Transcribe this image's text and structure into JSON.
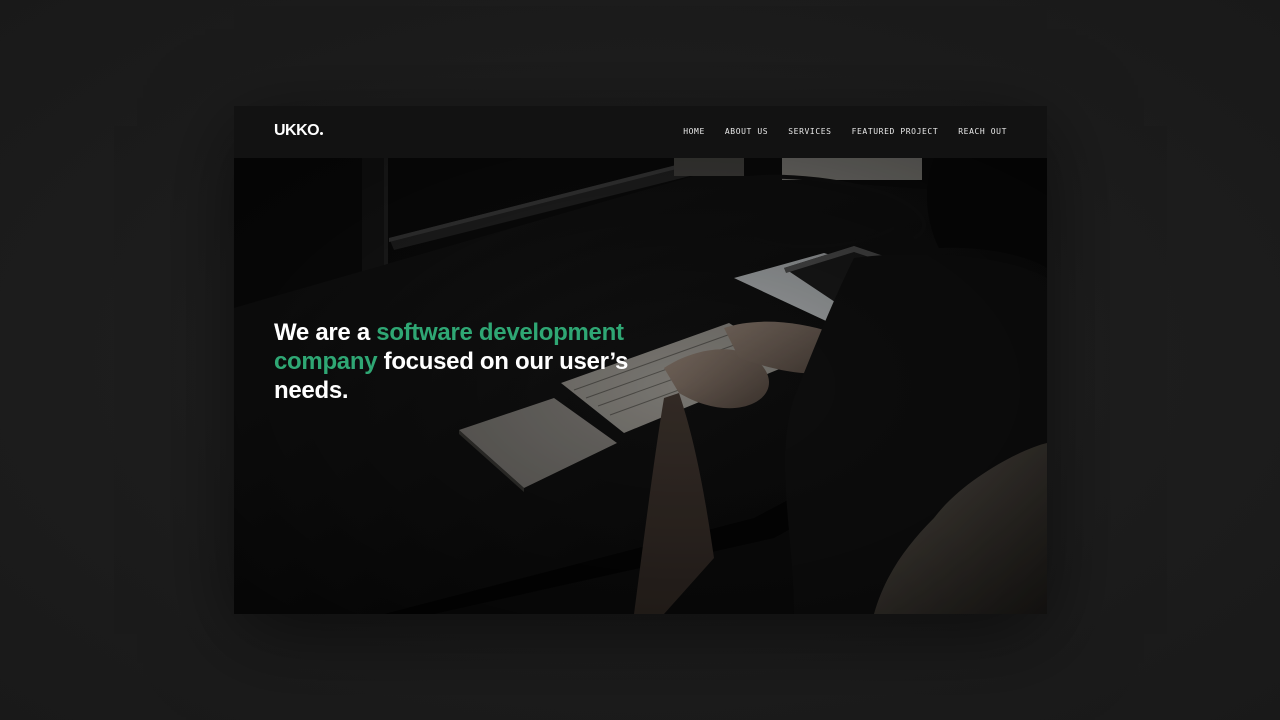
{
  "brand": {
    "logo_text": "UKKO",
    "accent_color": "#2fa774"
  },
  "nav": {
    "items": [
      {
        "label": "HOME"
      },
      {
        "label": "ABOUT US"
      },
      {
        "label": "SERVICES"
      },
      {
        "label": "FEATURED PROJECT"
      },
      {
        "label": "REACH OUT"
      }
    ]
  },
  "hero": {
    "headline_part1": "We are a ",
    "headline_accent": "software development company",
    "headline_part2": " focused on our user’s needs.",
    "background_icon": "person-typing-at-desk-photo"
  }
}
